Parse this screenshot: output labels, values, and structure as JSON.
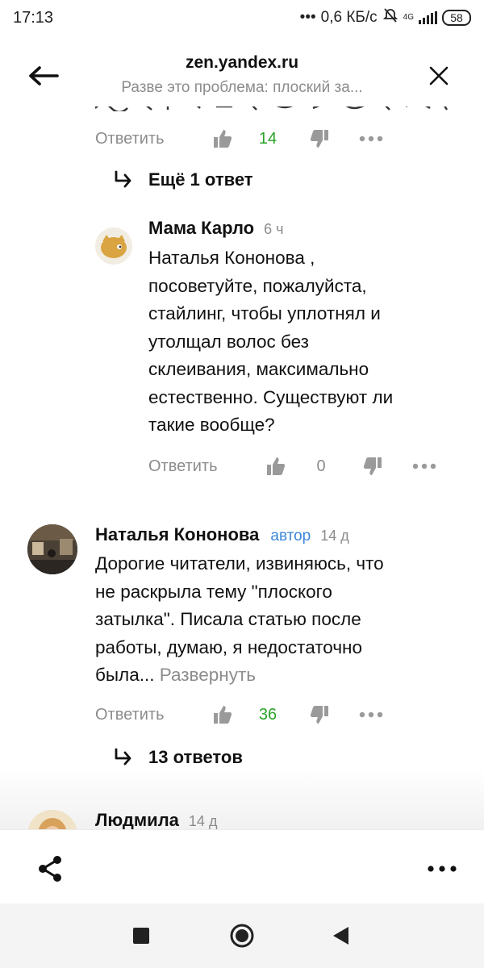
{
  "status_bar": {
    "time": "17:13",
    "network_speed": "0,6 КБ/с",
    "network_type": "4G",
    "battery": "58"
  },
  "top_bar": {
    "site": "zen.yandex.ru",
    "subtitle": "Разве это проблема: плоский за..."
  },
  "comments": {
    "top_reply_label": "Ответить",
    "top_like_count": "14",
    "more_replies_1": "Ещё 1 ответ",
    "reply": {
      "author": "Мама Карло",
      "time": "6 ч",
      "text_lines": [
        "Наталья Кононова ,",
        "посоветуйте, пожалуйста,",
        "стайлинг, чтобы уплотнял и",
        "утолщал волос без",
        "склеивания, максимально",
        "естественно. Существуют ли",
        "такие вообще?"
      ],
      "reply_label": "Ответить",
      "like_count": "0"
    },
    "main": {
      "author": "Наталья Кононова",
      "badge": "автор",
      "time": "14 д",
      "text_lines": [
        "Дорогие читатели, извиняюсь, что",
        "не раскрыла тему \"плоского",
        "затылка\". Писала статью после",
        "работы, думаю, я недостаточно"
      ],
      "text_last": "была... ",
      "expand_label": "Развернуть",
      "reply_label": "Ответить",
      "like_count": "36",
      "more_replies": "13 ответов"
    },
    "next": {
      "author": "Людмила",
      "time": "14 д"
    }
  },
  "icons": {
    "back": "arrow-left-icon",
    "close": "close-icon",
    "like": "thumbs-up-icon",
    "dislike": "thumbs-down-icon",
    "more": "more-dots-icon",
    "share": "share-icon",
    "menu": "menu-dots-icon"
  },
  "colors": {
    "like_count_green": "#29a329",
    "author_badge_blue": "#3a87d8",
    "muted_gray": "#8c8c8c"
  }
}
